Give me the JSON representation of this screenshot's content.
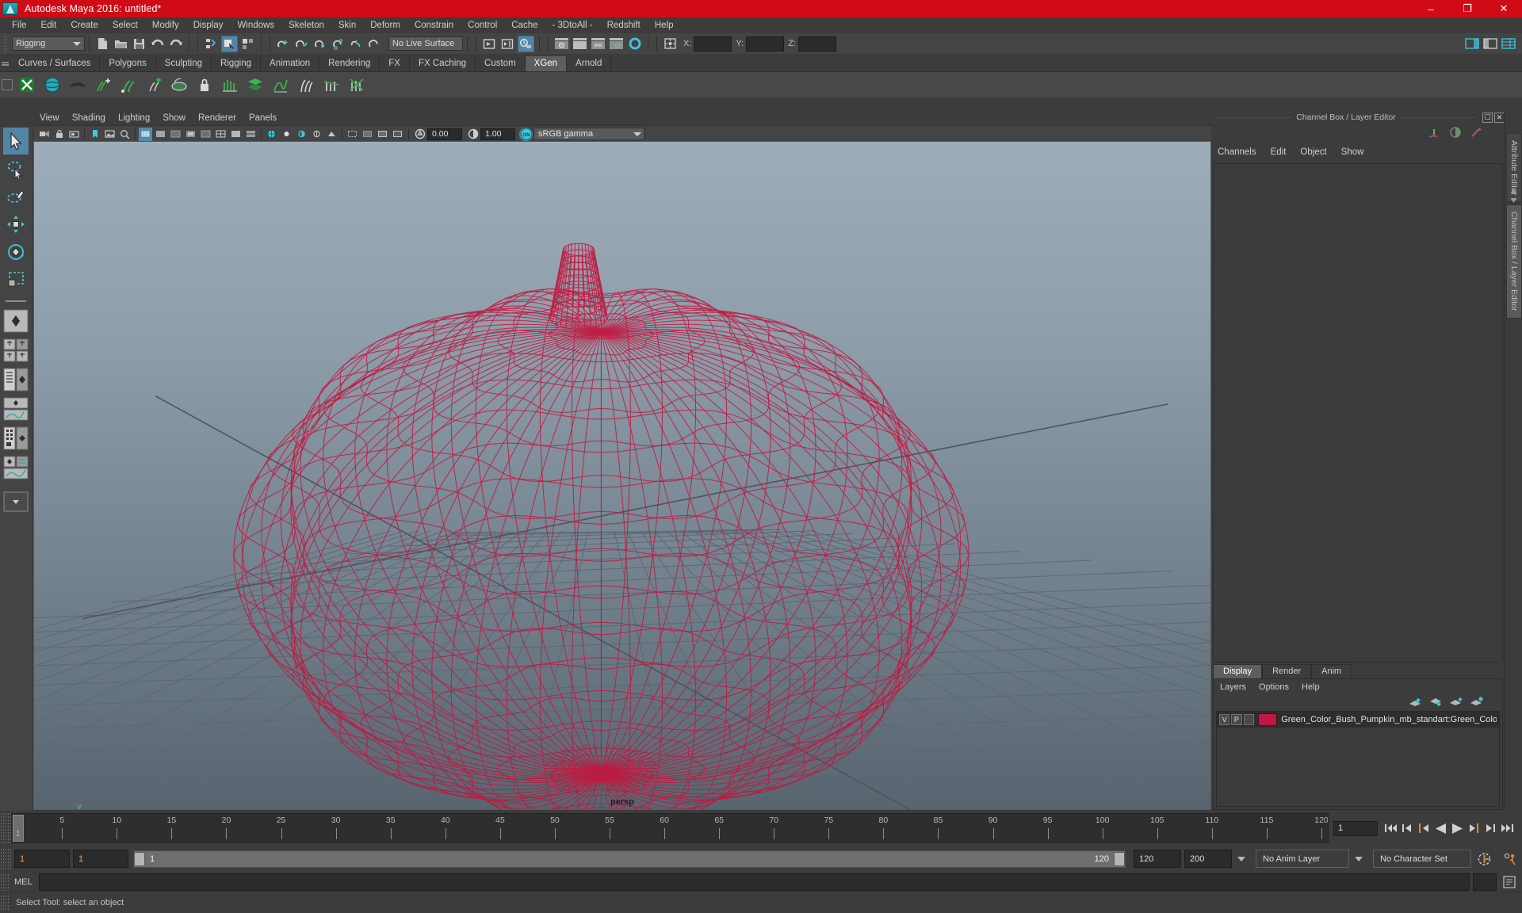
{
  "window": {
    "title": "Autodesk Maya 2016: untitled*",
    "logo": "maya-logo-icon",
    "minimize": "–",
    "maximize": "❐",
    "close": "✕"
  },
  "menubar": {
    "items": [
      {
        "label": "File"
      },
      {
        "label": "Edit"
      },
      {
        "label": "Create"
      },
      {
        "label": "Select"
      },
      {
        "label": "Modify"
      },
      {
        "label": "Display"
      },
      {
        "label": "Windows"
      },
      {
        "label": "Skeleton"
      },
      {
        "label": "Skin"
      },
      {
        "label": "Deform"
      },
      {
        "label": "Constrain"
      },
      {
        "label": "Control"
      },
      {
        "label": "Cache"
      },
      {
        "label": "- 3DtoAll -"
      },
      {
        "label": "Redshift"
      },
      {
        "label": "Help"
      }
    ]
  },
  "toolbar": {
    "menuset_value": "Rigging",
    "live_surface_value": "No Live Surface",
    "x_label": "X:",
    "y_label": "Y:",
    "z_label": "Z:",
    "x_value": "",
    "y_value": "",
    "z_value": "",
    "icons": [
      "new-scene-icon",
      "open-scene-icon",
      "save-scene-icon",
      "undo-icon",
      "redo-icon",
      "select-by-hierarchy-icon",
      "select-by-object-icon",
      "select-by-component-icon",
      "snap-to-grid-icon",
      "snap-to-curve-icon",
      "snap-to-point-icon",
      "snap-to-projected-center-icon",
      "snap-to-view-plane-icon",
      "make-live-icon",
      "render-current-frame-icon",
      "ipr-render-icon",
      "render-settings-icon",
      "hypershade-icon",
      "redshift-render-icon",
      "input-output-connections-icon"
    ]
  },
  "shelf": {
    "tabs": [
      {
        "label": "Curves / Surfaces",
        "selected": false
      },
      {
        "label": "Polygons",
        "selected": false
      },
      {
        "label": "Sculpting",
        "selected": false
      },
      {
        "label": "Rigging",
        "selected": false
      },
      {
        "label": "Animation",
        "selected": false
      },
      {
        "label": "Rendering",
        "selected": false
      },
      {
        "label": "FX",
        "selected": false
      },
      {
        "label": "FX Caching",
        "selected": false
      },
      {
        "label": "Custom",
        "selected": false
      },
      {
        "label": "XGen",
        "selected": true
      },
      {
        "label": "Arnold",
        "selected": false
      }
    ],
    "icons": [
      "xgen-create-description-icon",
      "xgen-sphere-icon",
      "xgen-dome-icon",
      "xgen-add-groom-icon",
      "xgen-density-brush-icon",
      "xgen-add-clump-icon",
      "xgen-region-icon",
      "xgen-lock-icon",
      "xgen-comb-icon",
      "xgen-layer-icon",
      "xgen-noise-icon",
      "xgen-guides-icon",
      "xgen-cut-icon",
      "xgen-delete-icon"
    ]
  },
  "toolbox": {
    "tools": [
      {
        "name": "select-tool",
        "selected": true
      },
      {
        "name": "lasso-select-tool",
        "selected": false
      },
      {
        "name": "paint-select-tool",
        "selected": false
      },
      {
        "name": "move-tool",
        "selected": false
      },
      {
        "name": "rotate-tool",
        "selected": false
      },
      {
        "name": "scale-tool",
        "selected": false
      }
    ],
    "layouts": [
      {
        "name": "single-perspective-layout"
      },
      {
        "name": "four-view-layout"
      },
      {
        "name": "outliner-persp-layout"
      },
      {
        "name": "persp-graph-layout"
      },
      {
        "name": "hypershade-persp-layout"
      },
      {
        "name": "persp-graph-outliner-layout"
      },
      {
        "name": "more-layouts-dropdown"
      }
    ]
  },
  "viewport": {
    "menus": [
      {
        "label": "View"
      },
      {
        "label": "Shading"
      },
      {
        "label": "Lighting"
      },
      {
        "label": "Show"
      },
      {
        "label": "Renderer"
      },
      {
        "label": "Panels"
      }
    ],
    "exposure_value": "0.00",
    "gamma_value": "1.00",
    "color_management_value": "sRGB gamma",
    "camera_label": "persp",
    "gate_toggle": "ON",
    "icons": [
      "select-camera-icon",
      "lock-camera-icon",
      "camera-attributes-icon",
      "bookmarks-icon",
      "image-plane-icon",
      "two-d-pan-zoom-icon",
      "grid-toggle-icon",
      "film-gate-icon",
      "resolution-gate-icon",
      "gate-mask-icon",
      "film-origin-icon",
      "wireframe-icon",
      "smooth-shade-icon",
      "shaded-wireframe-icon",
      "textured-icon",
      "use-lights-icon",
      "shadows-icon",
      "screen-space-ambient-occlusion-icon",
      "motion-blur-icon",
      "multisample-icon",
      "depth-of-field-icon",
      "isolate-select-icon",
      "xray-icon",
      "xray-joints-icon",
      "exposure-icon",
      "gamma-icon",
      "color-management-icon"
    ]
  },
  "channel_panel": {
    "title": "Channel Box / Layer Editor",
    "undock_icon": "undock-icon",
    "close_icon": "close-icon",
    "tool_icons": [
      "channel-box-icon",
      "attribute-editor-icon",
      "tool-settings-icon"
    ],
    "menus": [
      {
        "label": "Channels"
      },
      {
        "label": "Edit"
      },
      {
        "label": "Object"
      },
      {
        "label": "Show"
      }
    ],
    "vertical_tabs": [
      {
        "label": "Attribute Editor",
        "selected": false
      },
      {
        "label": "Channel Box / Layer Editor",
        "selected": true
      }
    ]
  },
  "layer_editor": {
    "tabs": [
      {
        "label": "Display",
        "selected": true
      },
      {
        "label": "Render",
        "selected": false
      },
      {
        "label": "Anim",
        "selected": false
      }
    ],
    "menus": [
      {
        "label": "Layers"
      },
      {
        "label": "Options"
      },
      {
        "label": "Help"
      }
    ],
    "icons": [
      "move-layer-up-icon",
      "move-layer-down-icon",
      "new-layer-icon",
      "new-layer-from-selected-icon"
    ],
    "layers": [
      {
        "visibility": "V",
        "playback": "P",
        "reference": "",
        "color": "#c2173f",
        "name": "Green_Color_Bush_Pumpkin_mb_standart:Green_Color_B"
      }
    ]
  },
  "timeline": {
    "start": 1,
    "end": 120,
    "current_frame": "1",
    "tick_labels": [
      "5",
      "10",
      "15",
      "20",
      "25",
      "30",
      "35",
      "40",
      "45",
      "50",
      "55",
      "60",
      "65",
      "70",
      "75",
      "80",
      "85",
      "90",
      "95",
      "100",
      "105",
      "110",
      "115",
      "120"
    ],
    "current_frame_field": "1",
    "playback_buttons": [
      "go-to-start-icon",
      "step-back-key-icon",
      "step-back-frame-icon",
      "play-backwards-icon",
      "play-forwards-icon",
      "step-forward-frame-icon",
      "step-forward-key-icon",
      "go-to-end-icon"
    ]
  },
  "range_slider": {
    "anim_start": "1",
    "range_start": "1",
    "bar_start_label": "1",
    "bar_end_label": "120",
    "range_end": "120",
    "anim_end": "200",
    "anim_layer": "No Anim Layer",
    "character_set": "No Character Set",
    "auto_key_icon": "auto-keyframe-icon",
    "anim_prefs_icon": "animation-preferences-icon"
  },
  "command_line": {
    "language_label": "MEL",
    "input_value": "",
    "input_placeholder": "",
    "script_editor_icon": "script-editor-icon"
  },
  "help_line": {
    "text": "Select Tool: select an object"
  },
  "scene": {
    "wireframe_color": "#c2173f",
    "grid_color": "#5e6a74",
    "axis_x_color": "#d1403f",
    "axis_y_color": "#4fbf4f",
    "axis_z_color": "#3f6fd1"
  }
}
